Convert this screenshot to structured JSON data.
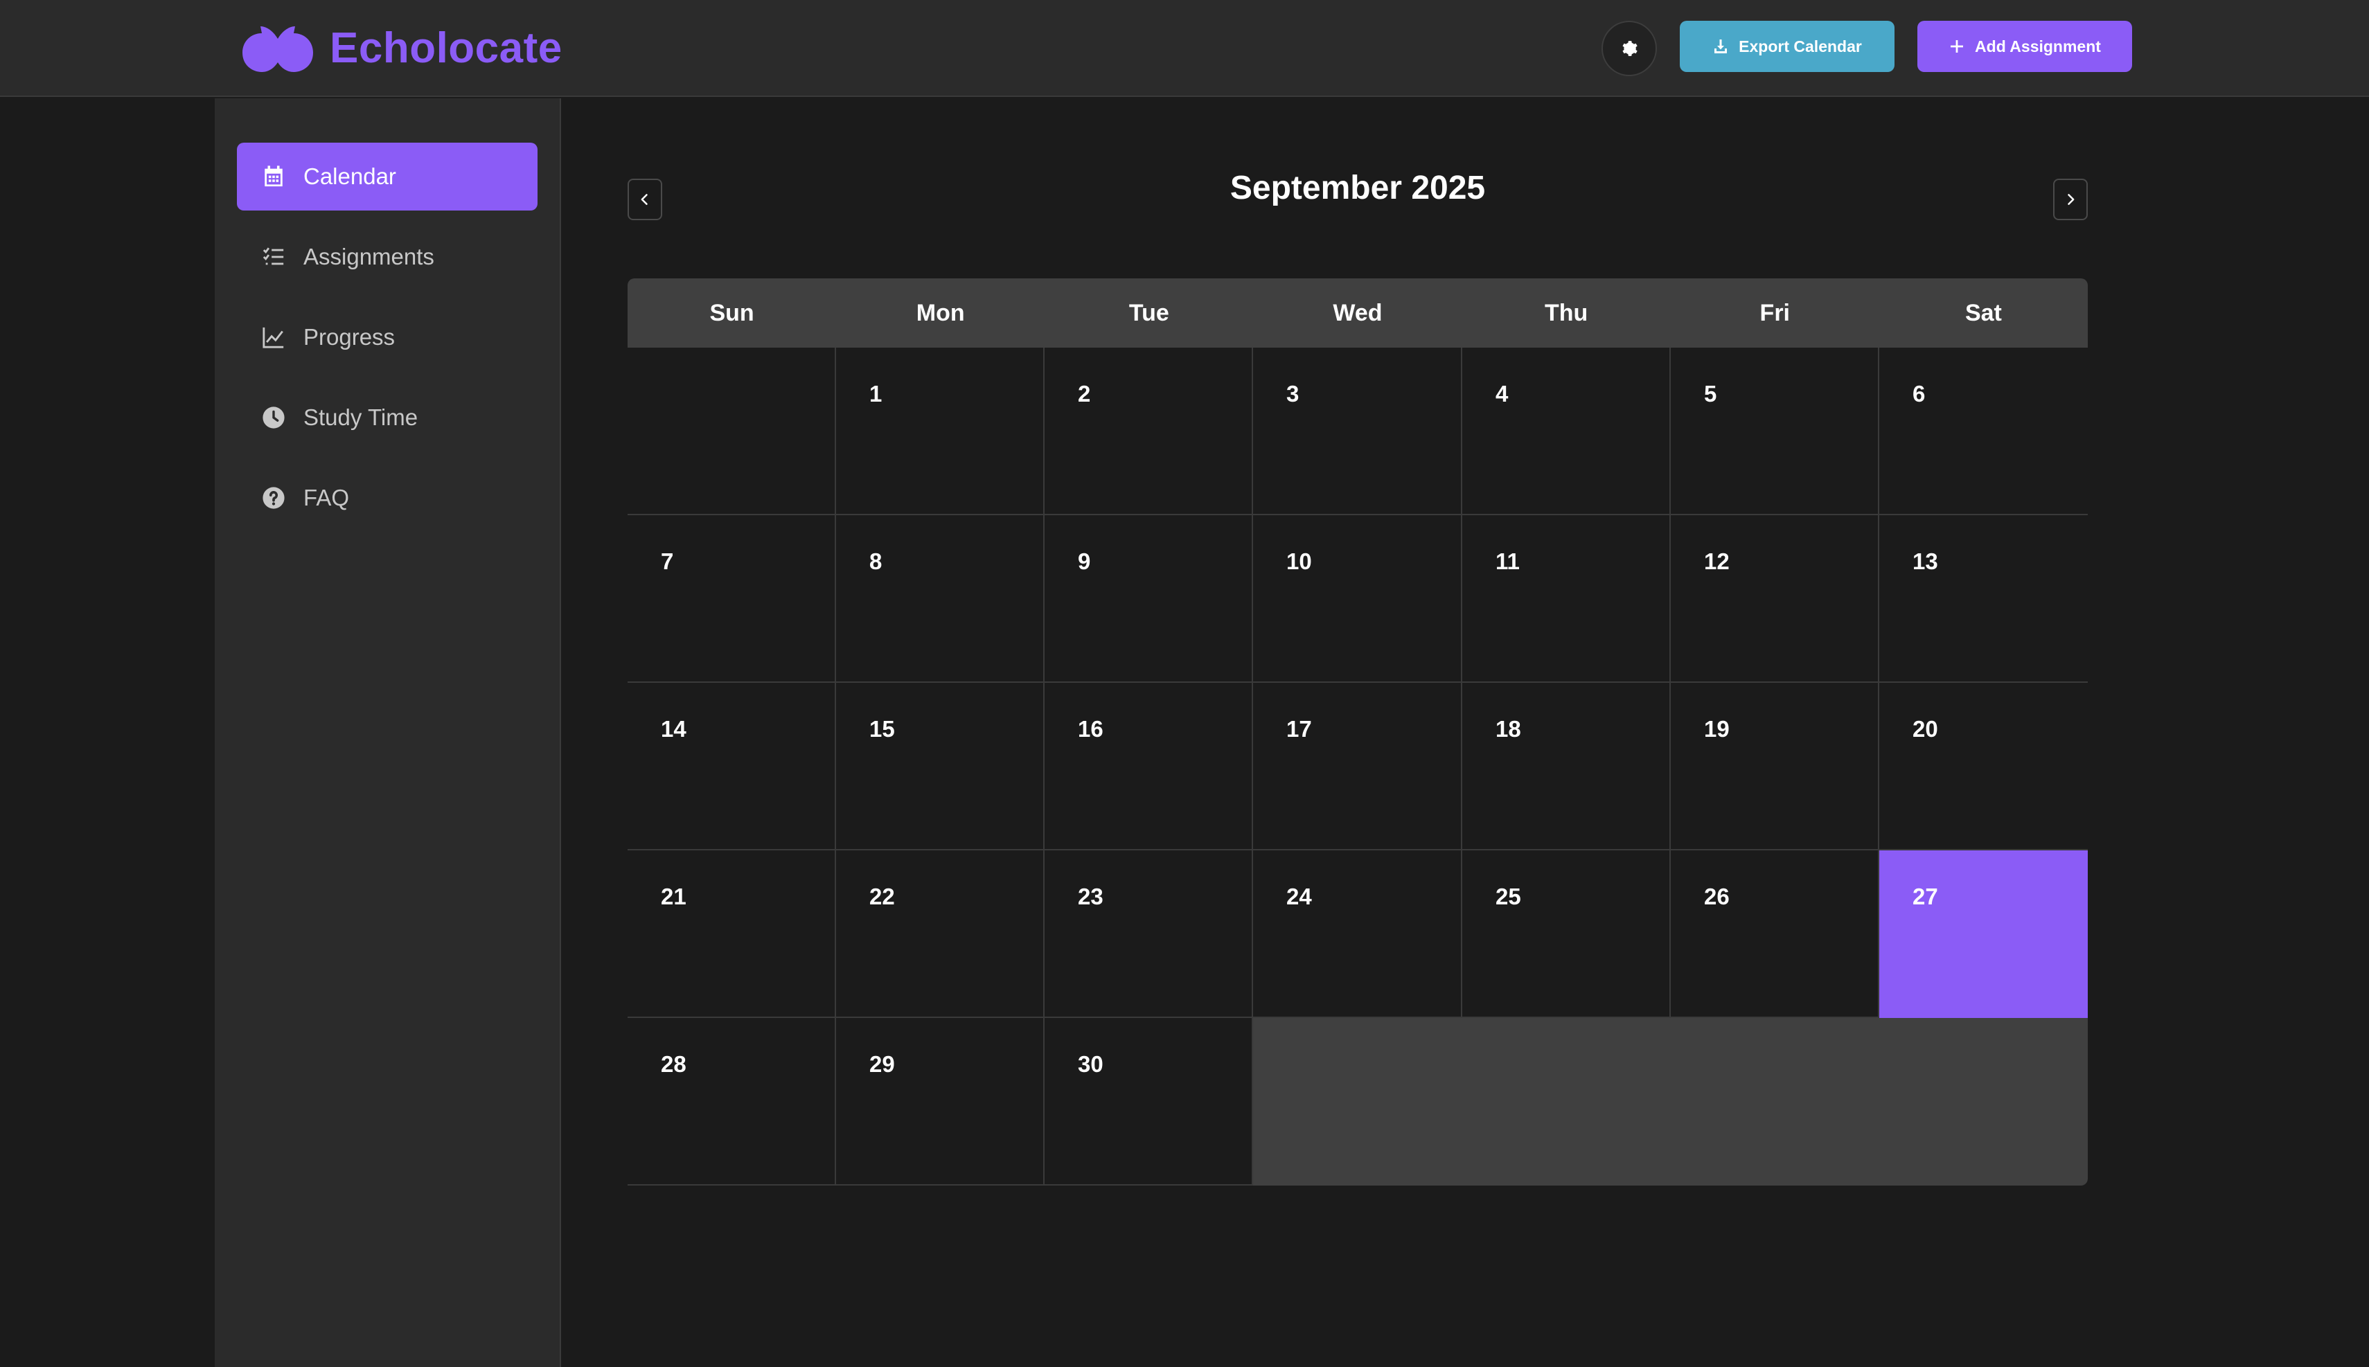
{
  "app": {
    "name": "Echolocate",
    "brand_color": "#8b5cf6"
  },
  "header": {
    "theme_toggle_icon": "gear-icon",
    "export_button": {
      "label": "Export Calendar",
      "icon": "download-icon",
      "color": "#4aa8c9"
    },
    "add_button": {
      "label": "Add Assignment",
      "icon": "plus-icon",
      "color": "#8b5cf6"
    }
  },
  "sidebar": {
    "items": [
      {
        "label": "Calendar",
        "icon": "calendar-icon",
        "active": true
      },
      {
        "label": "Assignments",
        "icon": "checklist-icon",
        "active": false
      },
      {
        "label": "Progress",
        "icon": "line-chart-icon",
        "active": false
      },
      {
        "label": "Study Time",
        "icon": "clock-icon",
        "active": false
      },
      {
        "label": "FAQ",
        "icon": "question-icon",
        "active": false
      }
    ]
  },
  "calendar": {
    "month_label": "September 2025",
    "weekdays": [
      "Sun",
      "Mon",
      "Tue",
      "Wed",
      "Thu",
      "Fri",
      "Sat"
    ],
    "leading_blank_days": 1,
    "days_in_month": 30,
    "today": 27,
    "today_color": "#8b5cf6"
  }
}
